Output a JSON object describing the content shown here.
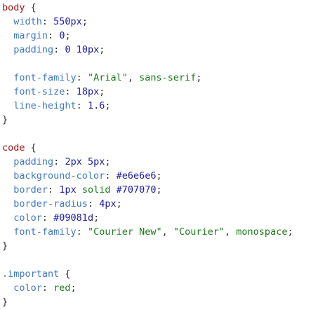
{
  "colors": {
    "selector": "#a31515",
    "property": "#4078c0",
    "number": "#1a1aa6",
    "string": "#1a7a1a",
    "keyword": "#1a7a1a",
    "punctuation": "#333333"
  },
  "lines": [
    [
      {
        "t": "sel",
        "v": "body"
      },
      {
        "t": "pun",
        "v": " {"
      }
    ],
    [
      {
        "t": "pun",
        "v": "  "
      },
      {
        "t": "prop",
        "v": "width"
      },
      {
        "t": "pun",
        "v": ": "
      },
      {
        "t": "num",
        "v": "550px"
      },
      {
        "t": "pun",
        "v": ";"
      }
    ],
    [
      {
        "t": "pun",
        "v": "  "
      },
      {
        "t": "prop",
        "v": "margin"
      },
      {
        "t": "pun",
        "v": ": "
      },
      {
        "t": "num",
        "v": "0"
      },
      {
        "t": "pun",
        "v": ";"
      }
    ],
    [
      {
        "t": "pun",
        "v": "  "
      },
      {
        "t": "prop",
        "v": "padding"
      },
      {
        "t": "pun",
        "v": ": "
      },
      {
        "t": "num",
        "v": "0 10px"
      },
      {
        "t": "pun",
        "v": ";"
      }
    ],
    [],
    [
      {
        "t": "pun",
        "v": "  "
      },
      {
        "t": "prop",
        "v": "font-family"
      },
      {
        "t": "pun",
        "v": ": "
      },
      {
        "t": "str",
        "v": "\"Arial\""
      },
      {
        "t": "pun",
        "v": ", "
      },
      {
        "t": "kw",
        "v": "sans-serif"
      },
      {
        "t": "pun",
        "v": ";"
      }
    ],
    [
      {
        "t": "pun",
        "v": "  "
      },
      {
        "t": "prop",
        "v": "font-size"
      },
      {
        "t": "pun",
        "v": ": "
      },
      {
        "t": "num",
        "v": "18px"
      },
      {
        "t": "pun",
        "v": ";"
      }
    ],
    [
      {
        "t": "pun",
        "v": "  "
      },
      {
        "t": "prop",
        "v": "line-height"
      },
      {
        "t": "pun",
        "v": ": "
      },
      {
        "t": "num",
        "v": "1.6"
      },
      {
        "t": "pun",
        "v": ";"
      }
    ],
    [
      {
        "t": "pun",
        "v": "}"
      }
    ],
    [],
    [
      {
        "t": "sel",
        "v": "code"
      },
      {
        "t": "pun",
        "v": " {"
      }
    ],
    [
      {
        "t": "pun",
        "v": "  "
      },
      {
        "t": "prop",
        "v": "padding"
      },
      {
        "t": "pun",
        "v": ": "
      },
      {
        "t": "num",
        "v": "2px 5px"
      },
      {
        "t": "pun",
        "v": ";"
      }
    ],
    [
      {
        "t": "pun",
        "v": "  "
      },
      {
        "t": "prop",
        "v": "background-color"
      },
      {
        "t": "pun",
        "v": ": "
      },
      {
        "t": "num",
        "v": "#e6e6e6"
      },
      {
        "t": "pun",
        "v": ";"
      }
    ],
    [
      {
        "t": "pun",
        "v": "  "
      },
      {
        "t": "prop",
        "v": "border"
      },
      {
        "t": "pun",
        "v": ": "
      },
      {
        "t": "num",
        "v": "1px"
      },
      {
        "t": "pun",
        "v": " "
      },
      {
        "t": "kw",
        "v": "solid"
      },
      {
        "t": "pun",
        "v": " "
      },
      {
        "t": "num",
        "v": "#707070"
      },
      {
        "t": "pun",
        "v": ";"
      }
    ],
    [
      {
        "t": "pun",
        "v": "  "
      },
      {
        "t": "prop",
        "v": "border-radius"
      },
      {
        "t": "pun",
        "v": ": "
      },
      {
        "t": "num",
        "v": "4px"
      },
      {
        "t": "pun",
        "v": ";"
      }
    ],
    [
      {
        "t": "pun",
        "v": "  "
      },
      {
        "t": "prop",
        "v": "color"
      },
      {
        "t": "pun",
        "v": ": "
      },
      {
        "t": "num",
        "v": "#09081d"
      },
      {
        "t": "pun",
        "v": ";"
      }
    ],
    [
      {
        "t": "pun",
        "v": "  "
      },
      {
        "t": "prop",
        "v": "font-family"
      },
      {
        "t": "pun",
        "v": ": "
      },
      {
        "t": "str",
        "v": "\"Courier New\""
      },
      {
        "t": "pun",
        "v": ", "
      },
      {
        "t": "str",
        "v": "\"Courier\""
      },
      {
        "t": "pun",
        "v": ", "
      },
      {
        "t": "kw",
        "v": "monospace"
      },
      {
        "t": "pun",
        "v": ";"
      }
    ],
    [
      {
        "t": "pun",
        "v": "}"
      }
    ],
    [],
    [
      {
        "t": "prop",
        "v": ".important"
      },
      {
        "t": "pun",
        "v": " {"
      }
    ],
    [
      {
        "t": "pun",
        "v": "  "
      },
      {
        "t": "prop",
        "v": "color"
      },
      {
        "t": "pun",
        "v": ": "
      },
      {
        "t": "kw",
        "v": "red"
      },
      {
        "t": "pun",
        "v": ";"
      }
    ],
    [
      {
        "t": "pun",
        "v": "}"
      }
    ]
  ]
}
